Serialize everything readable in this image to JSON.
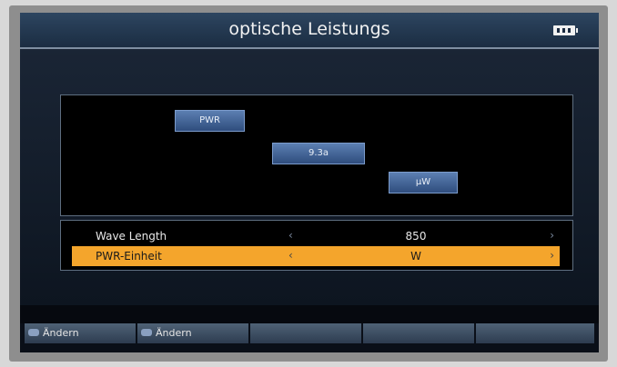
{
  "screen": {
    "title": "optische Leistungs",
    "graph": {
      "blocks": [
        {
          "label": "PWR"
        },
        {
          "label": "9.3a"
        },
        {
          "label": "µW"
        }
      ]
    },
    "menu": {
      "items": [
        {
          "label": "Wave Length",
          "value": "850",
          "left_arrow": "‹",
          "right_arrow": "›",
          "selected": false
        },
        {
          "label": "PWR-Einheit",
          "value": "W",
          "left_arrow": "‹",
          "right_arrow": "›",
          "selected": true
        }
      ]
    },
    "footer": {
      "keys": [
        {
          "label": "Ändern",
          "icon": "remote-key-icon"
        },
        {
          "label": "Ändern",
          "icon": "remote-key-icon"
        },
        {
          "label": ""
        },
        {
          "label": ""
        },
        {
          "label": ""
        }
      ]
    },
    "status": {
      "battery_icon": "battery-icon"
    }
  }
}
